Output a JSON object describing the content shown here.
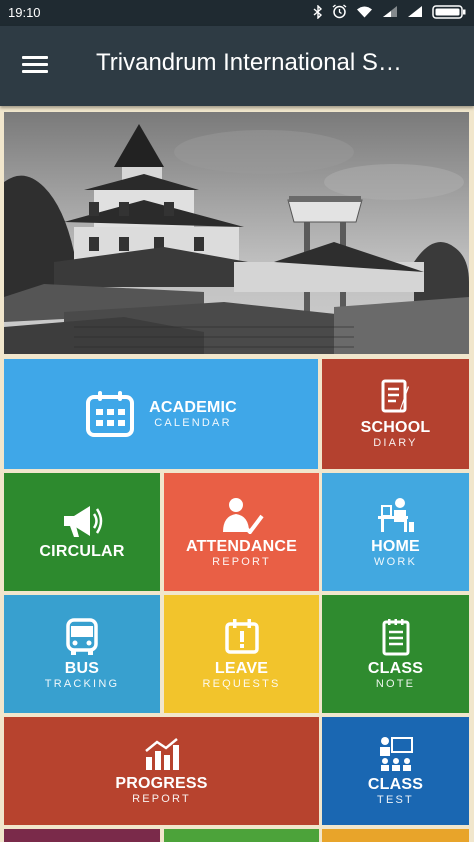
{
  "status_bar": {
    "time": "19:10"
  },
  "app_bar": {
    "title": "Trivandrum International S…"
  },
  "tiles": {
    "academic_calendar": {
      "line1": "ACADEMIC",
      "line2": "CALENDAR",
      "color": "#3fa7e8"
    },
    "school_diary": {
      "line1": "SCHOOL",
      "line2": "DIARY",
      "color": "#b4412f"
    },
    "circular": {
      "line1": "CIRCULAR",
      "line2": "",
      "color": "#2d8a2e"
    },
    "attendance_report": {
      "line1": "ATTENDANCE",
      "line2": "REPORT",
      "color": "#e95f45"
    },
    "home_work": {
      "line1": "HOME",
      "line2": "WORK",
      "color": "#42a8e0"
    },
    "bus_tracking": {
      "line1": "BUS",
      "line2": "TRACKING",
      "color": "#38a0cf"
    },
    "leave_requests": {
      "line1": "LEAVE",
      "line2": "REQUESTS",
      "color": "#f2c42c"
    },
    "class_note": {
      "line1": "CLASS",
      "line2": "NOTE",
      "color": "#2f8b2f"
    },
    "progress_report": {
      "line1": "PROGRESS",
      "line2": "REPORT",
      "color": "#b7432e"
    },
    "class_test": {
      "line1": "CLASS",
      "line2": "TEST",
      "color": "#1a67b2"
    }
  },
  "bottom_strip_colors": [
    "#7a2a4a",
    "#4ca33a",
    "#e8a42a"
  ]
}
